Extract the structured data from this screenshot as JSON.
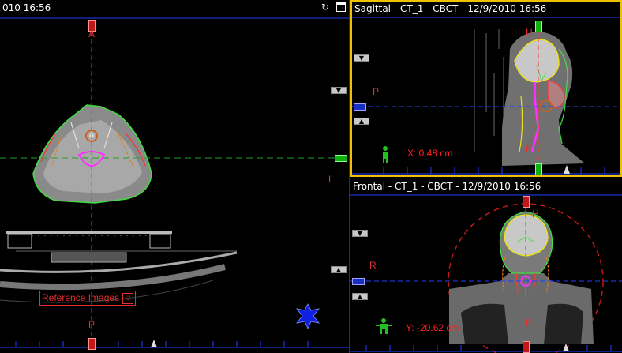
{
  "left_view": {
    "title": "010 16:56",
    "labels": {
      "anterior": "A",
      "posterior": "P",
      "left": "L"
    },
    "reference_button": "Reference Images"
  },
  "sagittal_view": {
    "title": "Sagittal - CT_1 - CBCT - 12/9/2010 16:56",
    "labels": {
      "head": "H",
      "posterior": "P",
      "foot": "F"
    },
    "readout": "X: 0.48 cm"
  },
  "frontal_view": {
    "title": "Frontal - CT_1 - CBCT - 12/9/2010 16:56",
    "labels": {
      "head": "H",
      "right": "R",
      "foot": "F"
    },
    "readout": "Y: -20.62 cm"
  },
  "colors": {
    "active_border": "#f0c000",
    "crosshair_blue": "#2040ff",
    "crosshair_red": "#ff3030",
    "contour_green": "#40e040",
    "contour_yellow": "#e8e020",
    "contour_magenta": "#ff30ff",
    "label_red": "#e03030"
  },
  "icons": [
    "refresh-icon",
    "maximize-icon",
    "orientation-star-icon",
    "person-figure-icon",
    "dropdown-arrow-icon"
  ]
}
